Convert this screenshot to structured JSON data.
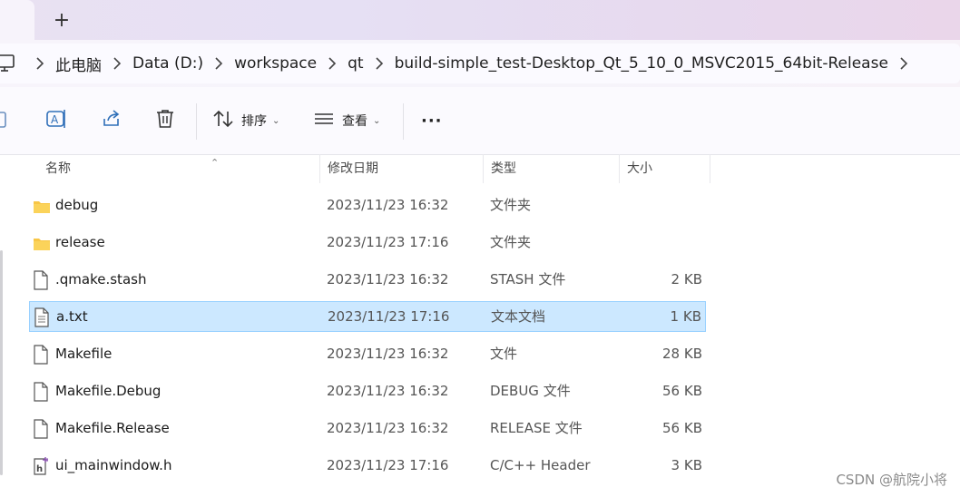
{
  "tabs": {
    "new_tab": "+"
  },
  "address": {
    "crumbs": [
      "此电脑",
      "Data (D:)",
      "workspace",
      "qt",
      "build-simple_test-Desktop_Qt_5_10_0_MSVC2015_64bit-Release"
    ]
  },
  "toolbar": {
    "sort_label": "排序",
    "view_label": "查看",
    "more_label": "···"
  },
  "columns": {
    "name": "名称",
    "date": "修改日期",
    "type": "类型",
    "size": "大小"
  },
  "files": [
    {
      "name": "debug",
      "date": "2023/11/23 16:32",
      "type": "文件夹",
      "size": "",
      "icon": "folder-icon"
    },
    {
      "name": "release",
      "date": "2023/11/23 17:16",
      "type": "文件夹",
      "size": "",
      "icon": "folder-icon"
    },
    {
      "name": ".qmake.stash",
      "date": "2023/11/23 16:32",
      "type": "STASH 文件",
      "size": "2 KB",
      "icon": "file-icon"
    },
    {
      "name": "a.txt",
      "date": "2023/11/23 17:16",
      "type": "文本文档",
      "size": "1 KB",
      "icon": "text-file-icon",
      "selected": true
    },
    {
      "name": "Makefile",
      "date": "2023/11/23 16:32",
      "type": "文件",
      "size": "28 KB",
      "icon": "file-icon"
    },
    {
      "name": "Makefile.Debug",
      "date": "2023/11/23 16:32",
      "type": "DEBUG 文件",
      "size": "56 KB",
      "icon": "file-icon"
    },
    {
      "name": "Makefile.Release",
      "date": "2023/11/23 16:32",
      "type": "RELEASE 文件",
      "size": "56 KB",
      "icon": "file-icon"
    },
    {
      "name": "ui_mainwindow.h",
      "date": "2023/11/23 17:16",
      "type": "C/C++ Header",
      "size": "3 KB",
      "icon": "header-file-icon"
    }
  ],
  "watermark": "CSDN @航院小将",
  "colors": {
    "selection": "#cce8ff",
    "selection_border": "#99d1ff",
    "folder": "#f8c646",
    "accent_blue": "#1f6fc5"
  }
}
